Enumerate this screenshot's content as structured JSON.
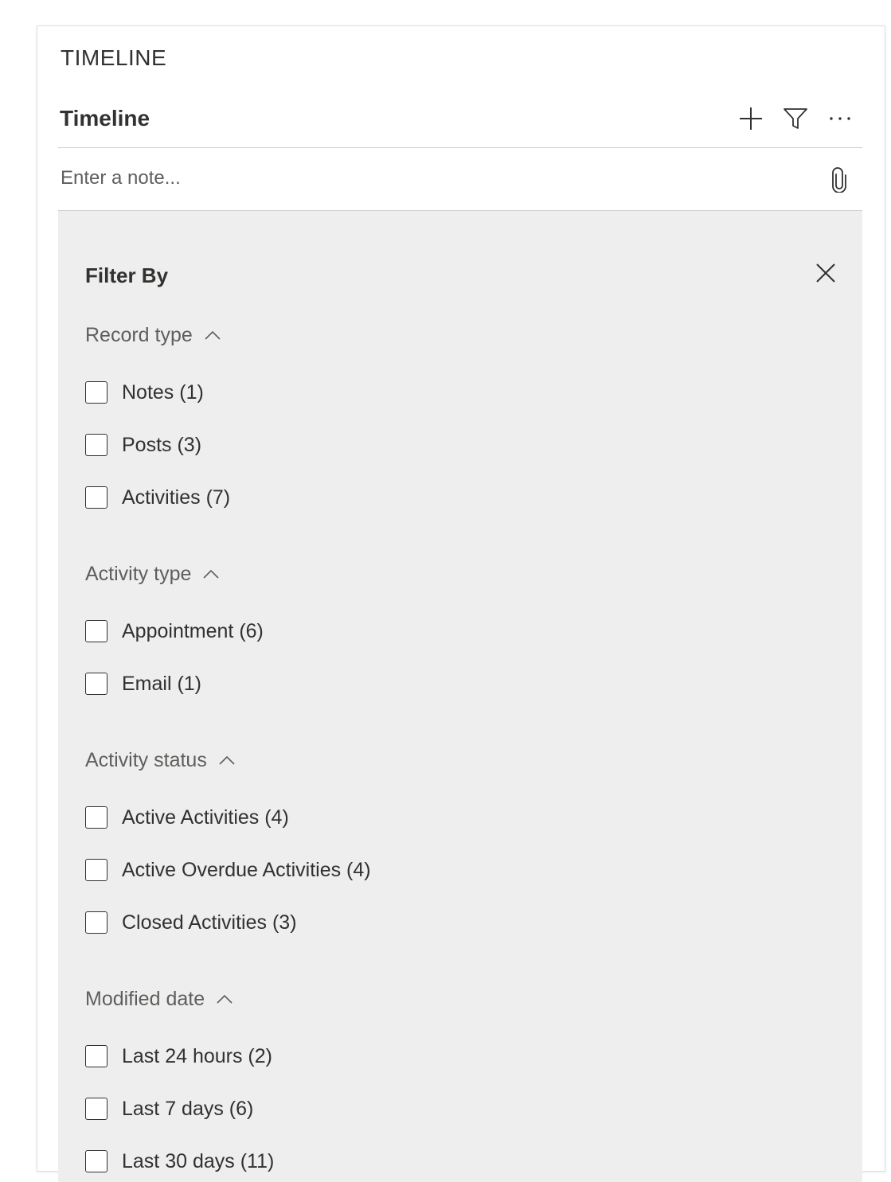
{
  "section_title": "TIMELINE",
  "header": {
    "title": "Timeline",
    "icons": [
      "add-icon",
      "filter-icon",
      "more-icon"
    ]
  },
  "note": {
    "placeholder": "Enter a note...",
    "value": ""
  },
  "filter": {
    "title": "Filter By",
    "groups": [
      {
        "label": "Record type",
        "options": [
          "Notes (1)",
          "Posts (3)",
          "Activities (7)"
        ]
      },
      {
        "label": "Activity type",
        "options": [
          "Appointment (6)",
          "Email (1)"
        ]
      },
      {
        "label": "Activity status",
        "options": [
          "Active Activities (4)",
          "Active Overdue Activities (4)",
          "Closed Activities (3)"
        ]
      },
      {
        "label": "Modified date",
        "options": [
          "Last 24 hours (2)",
          "Last 7 days (6)",
          "Last 30 days (11)"
        ]
      }
    ]
  },
  "colors": {
    "panel_bg": "#eeeeee",
    "text": "#323130",
    "muted_text": "#605e5c",
    "divider": "#d2d0ce"
  }
}
